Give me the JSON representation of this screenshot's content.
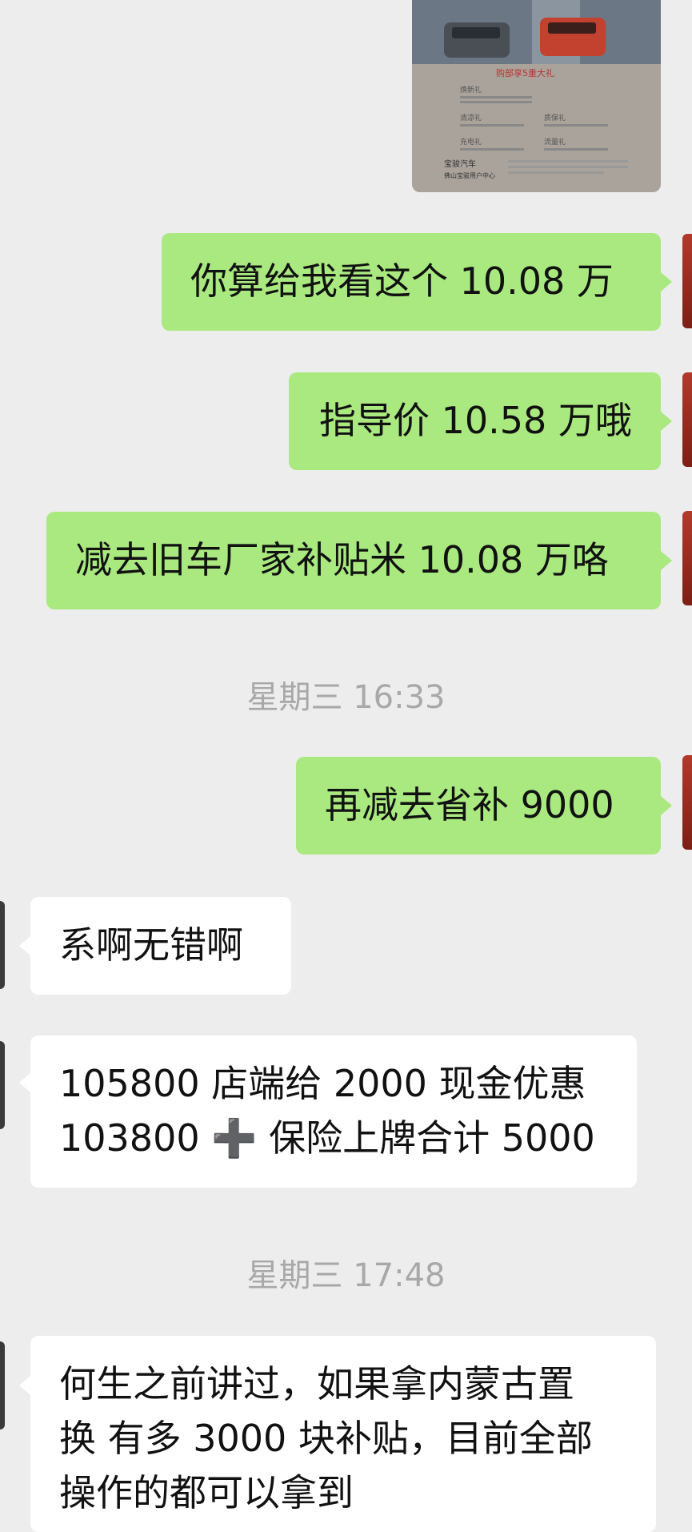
{
  "image_message": {
    "flyer_lines": [
      "购部享5重大礼",
      "焕新礼",
      "清凉礼",
      "质保礼",
      "充电礼",
      "流量礼",
      "宝骏汽车",
      "佛山宝骏用户中心"
    ]
  },
  "messages": [
    {
      "id": "m1",
      "sender": "me",
      "text": "你算给我看这个 10.08 万"
    },
    {
      "id": "m2",
      "sender": "me",
      "text": "指导价 10.58 万哦"
    },
    {
      "id": "m3",
      "sender": "me",
      "text": "减去旧车厂家补贴米 10.08 万咯"
    },
    {
      "id": "t1",
      "type": "timestamp",
      "text": "星期三 16:33"
    },
    {
      "id": "m4",
      "sender": "me",
      "text": "再减去省补 9000"
    },
    {
      "id": "m5",
      "sender": "other",
      "text": "系啊无错啊"
    },
    {
      "id": "m6",
      "sender": "other",
      "line1": "105800 店端给 2000 现金优惠",
      "line2_pre": "103800 ",
      "line2_icon": "➕",
      "line2_post": " 保险上牌合计 5000"
    },
    {
      "id": "t2",
      "type": "timestamp",
      "text": "星期三 17:48"
    },
    {
      "id": "m7",
      "sender": "other",
      "line1": "何生之前讲过，如果拿内蒙古置",
      "line2": "换 有多 3000 块补贴，目前全部",
      "line3": "操作的都可以拿到"
    }
  ],
  "colors": {
    "background": "#ededed",
    "outgoing_bubble": "#a9e97f",
    "incoming_bubble": "#ffffff",
    "timestamp_text": "#a8a8a8"
  }
}
